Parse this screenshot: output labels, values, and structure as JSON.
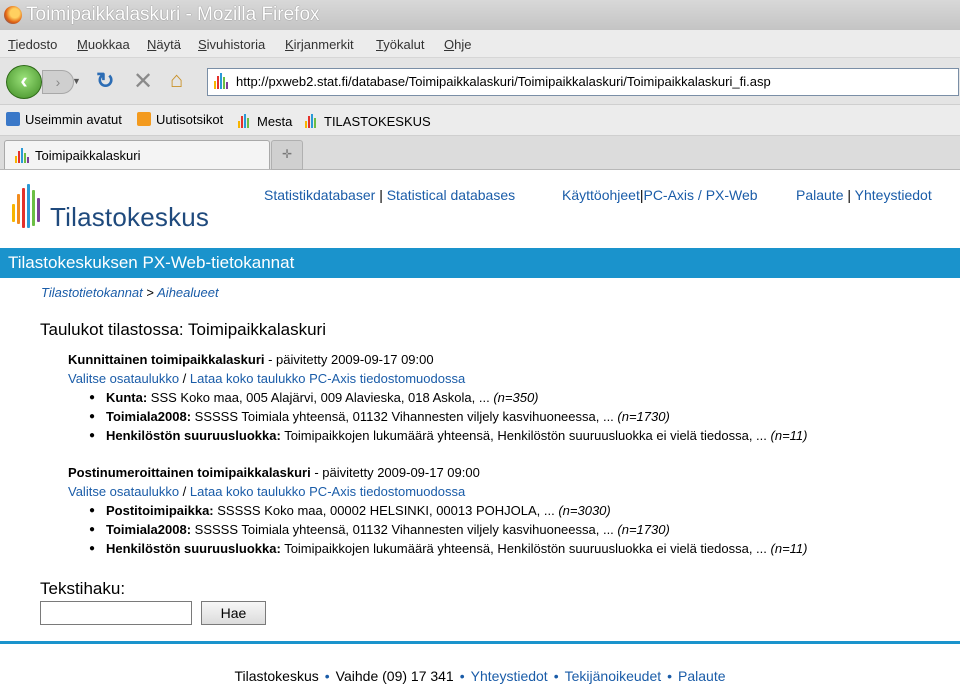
{
  "window": {
    "title": "Toimipaikkalaskuri - Mozilla Firefox"
  },
  "menu": [
    "Tiedosto",
    "Muokkaa",
    "Näytä",
    "Sivuhistoria",
    "Kirjanmerkit",
    "Työkalut",
    "Ohje"
  ],
  "url": "http://pxweb2.stat.fi/database/Toimipaikkalaskuri/Toimipaikkalaskuri/Toimipaikkalaskuri_fi.asp",
  "bookmarks": [
    "Useimmin avatut",
    "Uutisotsikot",
    "Mesta",
    "TILASTOKESKUS"
  ],
  "tab": {
    "label": "Toimipaikkalaskuri"
  },
  "site": {
    "logo_text": "Tilastokeskus",
    "toplinks": {
      "statistikdatabaser": "Statistikdatabaser",
      "statistical_databases": "Statistical databases",
      "kayttoohjeet": "Käyttöohjeet",
      "pcaxis": "PC-Axis / PX-Web",
      "palaute": "Palaute",
      "yhteystiedot": "Yhteystiedot",
      "sep": "|"
    },
    "banner": "Tilastokeskuksen PX-Web-tietokannat",
    "breadcrumb": {
      "a": "Tilastotietokannat",
      "sep": ">",
      "b": "Aihealueet"
    },
    "heading": "Taulukot tilastossa: Toimipaikkalaskuri"
  },
  "tables": [
    {
      "name": "Kunnittainen toimipaikkalaskuri",
      "updated": " - päivitetty 2009-09-17 09:00",
      "link1": "Valitse osataulukko",
      "slash": " / ",
      "link2": "Lataa koko taulukko PC-Axis tiedostomuodossa",
      "vars": [
        {
          "label": "Kunta:",
          "text": " SSS Koko maa, 005 Alajärvi, 009 Alavieska, 018 Askola, ... ",
          "count": "(n=350)"
        },
        {
          "label": "Toimiala2008:",
          "text": " SSSSS Toimiala yhteensä, 01132 Vihannesten viljely kasvihuoneessa, ... ",
          "count": "(n=1730)"
        },
        {
          "label": "Henkilöstön suuruusluokka:",
          "text": " Toimipaikkojen lukumäärä yhteensä, Henkilöstön suuruusluokka ei vielä tiedossa, ... ",
          "count": "(n=11)"
        }
      ]
    },
    {
      "name": "Postinumeroittainen toimipaikkalaskuri",
      "updated": " - päivitetty 2009-09-17 09:00",
      "link1": "Valitse osataulukko",
      "slash": " / ",
      "link2": "Lataa koko taulukko PC-Axis tiedostomuodossa",
      "vars": [
        {
          "label": "Postitoimipaikka:",
          "text": " SSSSS Koko maa, 00002 HELSINKI, 00013 POHJOLA, ... ",
          "count": "(n=3030)"
        },
        {
          "label": "Toimiala2008:",
          "text": " SSSSS Toimiala yhteensä, 01132 Vihannesten viljely kasvihuoneessa, ... ",
          "count": "(n=1730)"
        },
        {
          "label": "Henkilöstön suuruusluokka:",
          "text": " Toimipaikkojen lukumäärä yhteensä, Henkilöstön suuruusluokka ei vielä tiedossa, ... ",
          "count": "(n=11)"
        }
      ]
    }
  ],
  "search": {
    "label": "Tekstihaku:",
    "value": "",
    "button": "Hae"
  },
  "footer": {
    "org": "Tilastokeskus",
    "phone": "Vaihde (09) 17 341",
    "yhteystiedot": "Yhteystiedot",
    "tekijanoikeudet": "Tekijänoikeudet",
    "palaute": "Palaute",
    "dot": "•"
  },
  "colors": {
    "banner": "#1a93cc",
    "link": "#1a5ca8",
    "logo_text": "#1f4a7d"
  }
}
